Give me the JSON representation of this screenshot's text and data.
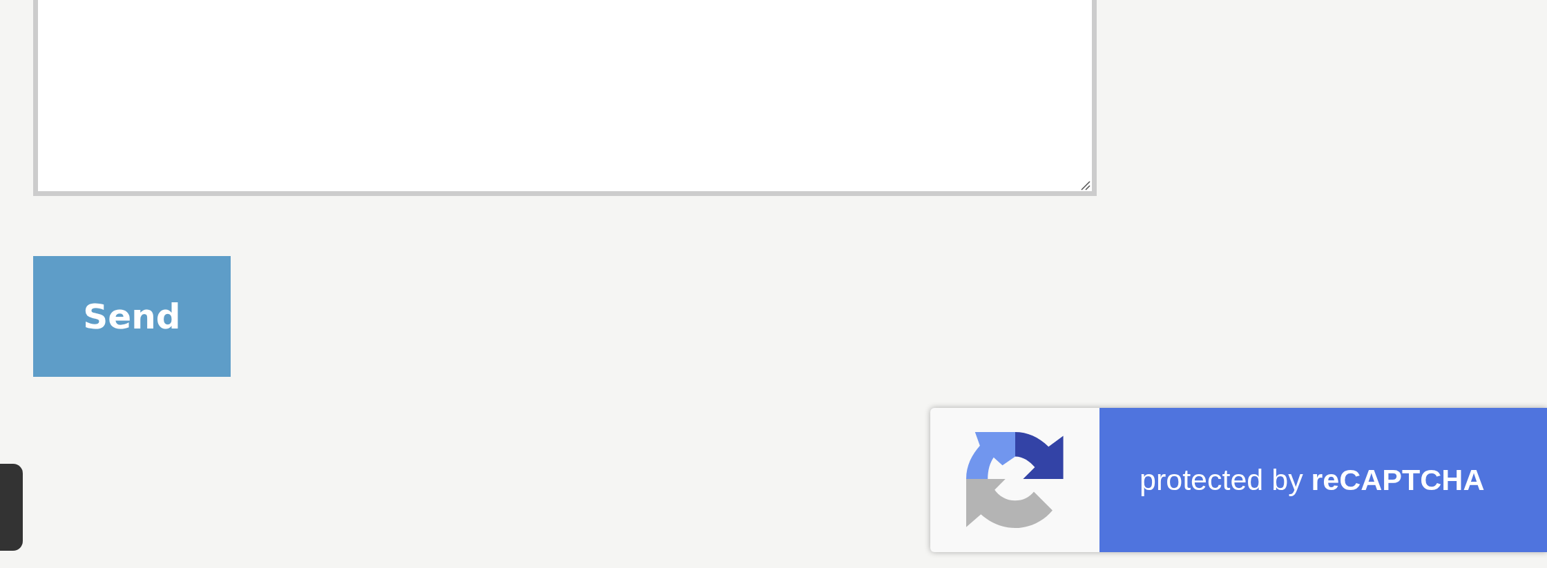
{
  "form": {
    "message_field": {
      "resizable": true
    },
    "send_button": {
      "label": "Send"
    }
  },
  "recaptcha_badge": {
    "text": "protected by **reCAPTCHA**"
  }
}
